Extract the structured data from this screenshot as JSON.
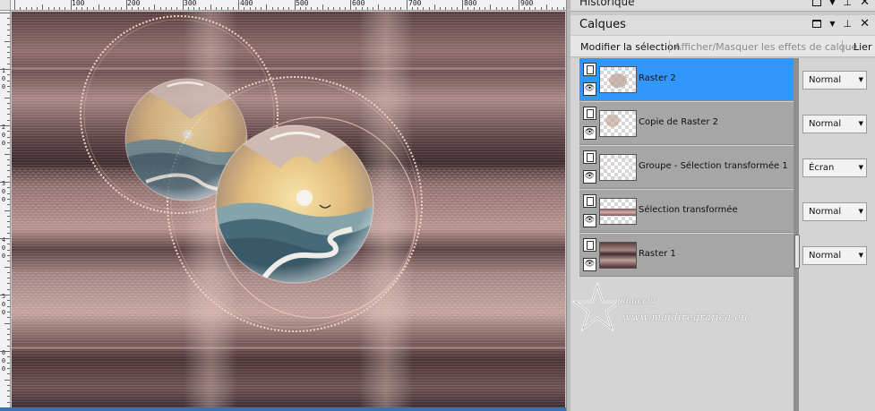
{
  "ruler": {
    "h_labels": [
      "100",
      "200",
      "300",
      "400",
      "500",
      "600",
      "700",
      "800",
      "900"
    ],
    "v_labels": [
      "1",
      "0",
      "0",
      "2",
      "0",
      "0",
      "3",
      "0",
      "0",
      "4",
      "0",
      "0",
      "5",
      "0",
      "0",
      "6",
      "0",
      "0"
    ]
  },
  "panels": {
    "history_title": "Historique",
    "layers_title": "Calques"
  },
  "toolbar": {
    "modify_selection": "Modifier la sélection",
    "show_hide_effects": "Afficher/Masquer les effets de calque",
    "link": "Lier"
  },
  "layers": [
    {
      "name": "Raster 2",
      "blend_mode": "Normal",
      "selected": true
    },
    {
      "name": "Copie de Raster 2",
      "blend_mode": "Normal",
      "selected": false
    },
    {
      "name": "Groupe - Sélection transformée 1",
      "blend_mode": "Écran",
      "selected": false
    },
    {
      "name": "Sélection transformée",
      "blend_mode": "Normal",
      "selected": false
    },
    {
      "name": "Raster 1",
      "blend_mode": "Normal",
      "selected": false
    }
  ],
  "watermark": {
    "line1": "pinuccia",
    "line2": "www.maidiregrafica.eu"
  },
  "colors": {
    "selected_row": "#3297fd",
    "row": "#a6a6a6",
    "canvas_dark": "#4e3538",
    "canvas_mid": "#8d6a6b",
    "canvas_light": "#d9b6ab"
  }
}
